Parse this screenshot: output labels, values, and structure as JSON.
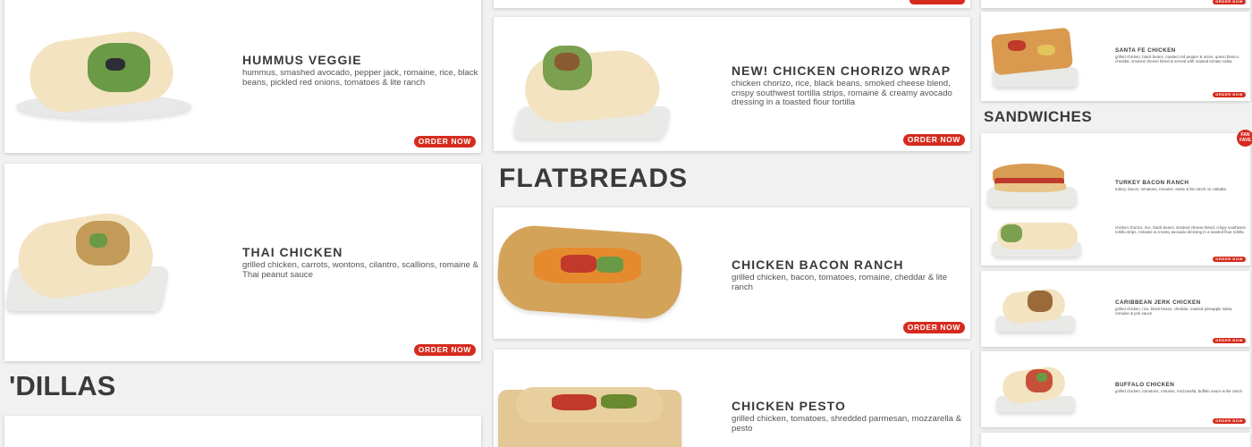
{
  "colors": {
    "accent": "#d52b1e",
    "card": "#ffffff",
    "background": "#f1f1f1",
    "title": "#3a3a3a"
  },
  "order_label": "ORDER NOW",
  "left_column": {
    "items": [
      {
        "name": "HUMMUS VEGGIE",
        "desc": "hummus, smashed avocado, pepper jack, romaine, rice, black beans, pickled red onions, tomatoes & lite ranch"
      },
      {
        "name": "THAI CHICKEN",
        "desc": "grilled chicken, carrots, wontons, cilantro, scallions, romaine & Thai peanut sauce"
      }
    ],
    "section_title": "'DILLAS"
  },
  "middle_column": {
    "items": [
      {
        "name": "NEW! CHICKEN CHORIZO WRAP",
        "desc": "chicken chorizo, rice, black beans, smoked cheese blend, crispy southwest tortilla strips, romaine & creamy avocado dressing in a toasted flour tortilla"
      }
    ],
    "section_title": "FLATBREADS",
    "flatbreads": [
      {
        "name": "CHICKEN BACON RANCH",
        "desc": "grilled chicken, bacon, tomatoes, romaine, cheddar & lite ranch"
      },
      {
        "name": "CHICKEN PESTO",
        "desc": "grilled chicken, tomatoes, shredded parmesan, mozzarella & pesto"
      }
    ]
  },
  "right_column": {
    "items": [
      {
        "name": "SANTA FE CHICKEN",
        "desc": "grilled chicken, black beans, roasted red pepper & onion, queso blanco, cheddar, smoked cheese blend & served with roasted tomato salsa"
      }
    ],
    "section_title": "SANDWICHES",
    "badge": "FAN FAVE",
    "sandwiches": [
      {
        "name": "TURKEY BACON RANCH",
        "desc": "turkey, bacon, tomatoes, romaine, swiss & lite ranch on ciabatta",
        "desc2": "chicken chorizo, rice, black beans, smoked cheese blend, crispy southwest tortilla strips, romaine & creamy avocado dressing in a toasted flour tortilla"
      },
      {
        "name": "CARIBBEAN JERK CHICKEN",
        "desc": "grilled chicken, rice, black beans, cheddar, roasted pineapple salsa, romaine & jerk sauce"
      },
      {
        "name": "BUFFALO CHICKEN",
        "desc": "grilled chicken, tomatoes, romaine, mozzarella, buffalo sauce & lite ranch"
      }
    ]
  }
}
